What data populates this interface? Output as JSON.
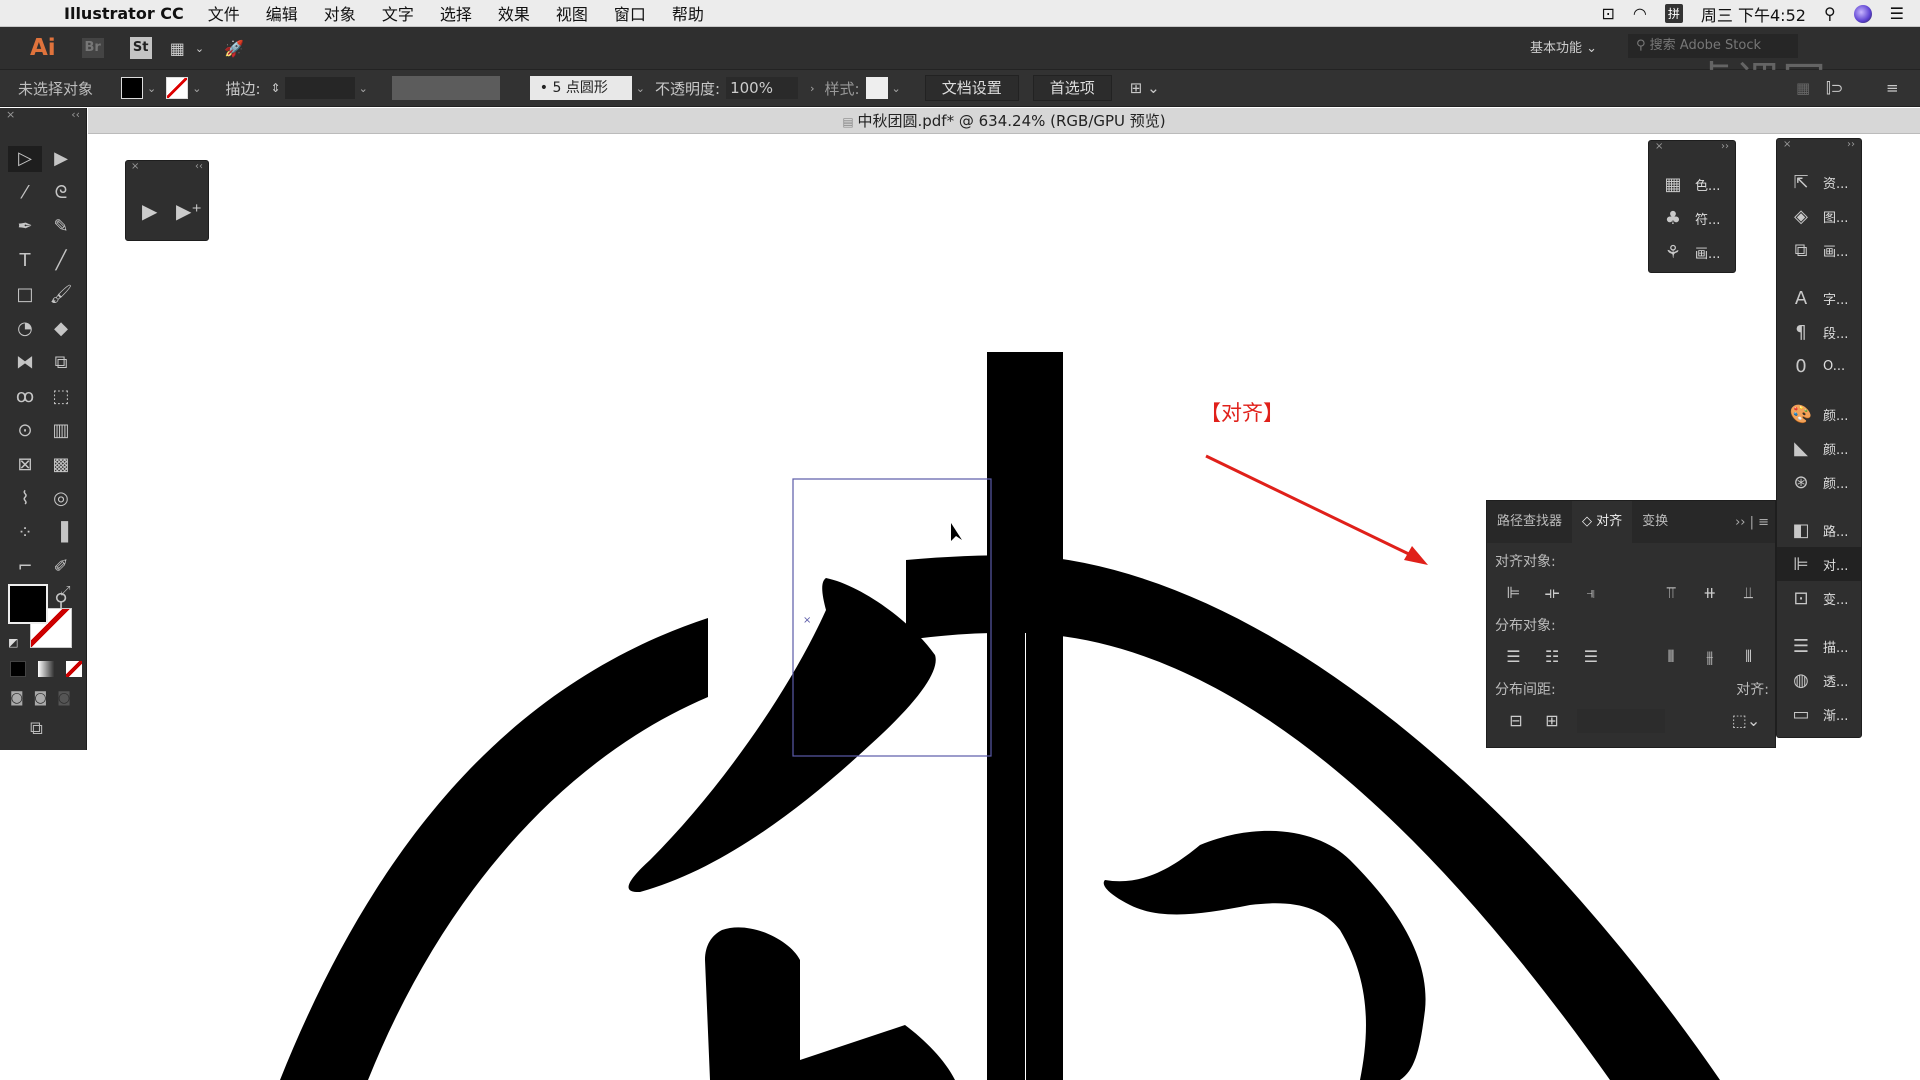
{
  "menubar": {
    "app_name": "Illustrator CC",
    "items": [
      "文件",
      "编辑",
      "对象",
      "文字",
      "选择",
      "效果",
      "视图",
      "窗口",
      "帮助"
    ],
    "status": {
      "input_method": "拼",
      "clock": "周三 下午4:52"
    }
  },
  "appbar": {
    "logo": "Ai",
    "bridge": "Br",
    "stock": "St",
    "workspace": "基本功能",
    "search_placeholder": "搜索 Adobe Stock",
    "watermark": "虎课网"
  },
  "controlbar": {
    "selection_status": "未选择对象",
    "stroke_label": "描边:",
    "brush": "5 点圆形",
    "opacity_label": "不透明度:",
    "opacity_value": "100%",
    "style_label": "样式:",
    "doc_setup_button": "文档设置",
    "preferences_button": "首选项"
  },
  "document": {
    "tab_title": "中秋团圆.pdf* @ 634.24% (RGB/GPU 预览)"
  },
  "annotation": {
    "label": "【对齐】",
    "color": "#e0201a"
  },
  "panels": {
    "swatches_group": [
      {
        "icon": "swatches-icon",
        "label": "色..."
      },
      {
        "icon": "symbols-icon",
        "label": "符..."
      },
      {
        "icon": "brushes-icon",
        "label": "画..."
      }
    ],
    "main_group": [
      {
        "icon": "asset-export-icon",
        "label": "资..."
      },
      {
        "icon": "layers-icon",
        "label": "图..."
      },
      {
        "icon": "artboards-icon",
        "label": "画..."
      },
      {
        "icon": "character-icon",
        "label": "字..."
      },
      {
        "icon": "paragraph-icon",
        "label": "段..."
      },
      {
        "icon": "opentype-icon",
        "label": "O..."
      },
      {
        "icon": "color-icon",
        "label": "颜..."
      },
      {
        "icon": "color-guide-icon",
        "label": "颜..."
      },
      {
        "icon": "color-themes-icon",
        "label": "颜..."
      },
      {
        "icon": "pathfinder-icon",
        "label": "路..."
      },
      {
        "icon": "align-icon",
        "label": "对..."
      },
      {
        "icon": "transform-icon",
        "label": "变..."
      },
      {
        "icon": "stroke-icon",
        "label": "描..."
      },
      {
        "icon": "transparency-icon",
        "label": "透..."
      },
      {
        "icon": "gradient-icon",
        "label": "渐..."
      }
    ],
    "align": {
      "tabs": [
        "路径查找器",
        "对齐",
        "变换"
      ],
      "active_tab": "对齐",
      "align_objects_label": "对齐对象:",
      "distribute_objects_label": "分布对象:",
      "distribute_spacing_label": "分布间距:",
      "align_to_label": "对齐:"
    }
  }
}
